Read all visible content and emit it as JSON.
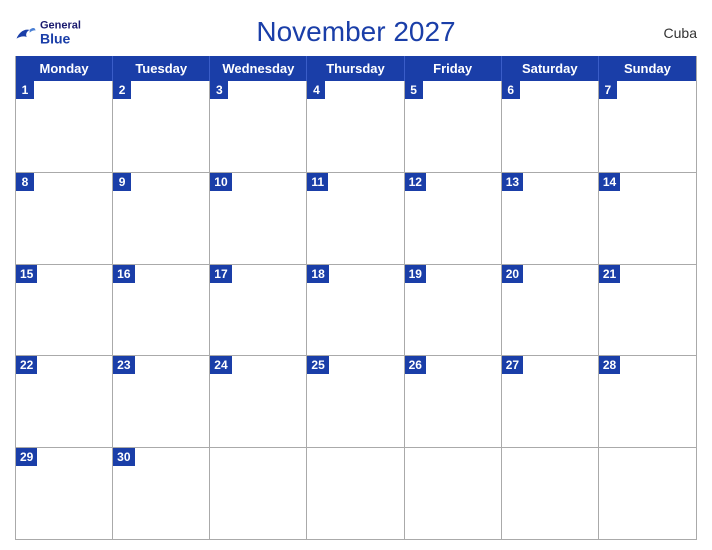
{
  "header": {
    "title": "November 2027",
    "country": "Cuba",
    "logo_general": "General",
    "logo_blue": "Blue"
  },
  "days_of_week": [
    "Monday",
    "Tuesday",
    "Wednesday",
    "Thursday",
    "Friday",
    "Saturday",
    "Sunday"
  ],
  "weeks": [
    [
      {
        "date": 1,
        "empty": false
      },
      {
        "date": 2,
        "empty": false
      },
      {
        "date": 3,
        "empty": false
      },
      {
        "date": 4,
        "empty": false
      },
      {
        "date": 5,
        "empty": false
      },
      {
        "date": 6,
        "empty": false
      },
      {
        "date": 7,
        "empty": false
      }
    ],
    [
      {
        "date": 8,
        "empty": false
      },
      {
        "date": 9,
        "empty": false
      },
      {
        "date": 10,
        "empty": false
      },
      {
        "date": 11,
        "empty": false
      },
      {
        "date": 12,
        "empty": false
      },
      {
        "date": 13,
        "empty": false
      },
      {
        "date": 14,
        "empty": false
      }
    ],
    [
      {
        "date": 15,
        "empty": false
      },
      {
        "date": 16,
        "empty": false
      },
      {
        "date": 17,
        "empty": false
      },
      {
        "date": 18,
        "empty": false
      },
      {
        "date": 19,
        "empty": false
      },
      {
        "date": 20,
        "empty": false
      },
      {
        "date": 21,
        "empty": false
      }
    ],
    [
      {
        "date": 22,
        "empty": false
      },
      {
        "date": 23,
        "empty": false
      },
      {
        "date": 24,
        "empty": false
      },
      {
        "date": 25,
        "empty": false
      },
      {
        "date": 26,
        "empty": false
      },
      {
        "date": 27,
        "empty": false
      },
      {
        "date": 28,
        "empty": false
      }
    ],
    [
      {
        "date": 29,
        "empty": false
      },
      {
        "date": 30,
        "empty": false
      },
      {
        "date": null,
        "empty": true
      },
      {
        "date": null,
        "empty": true
      },
      {
        "date": null,
        "empty": true
      },
      {
        "date": null,
        "empty": true
      },
      {
        "date": null,
        "empty": true
      }
    ]
  ]
}
